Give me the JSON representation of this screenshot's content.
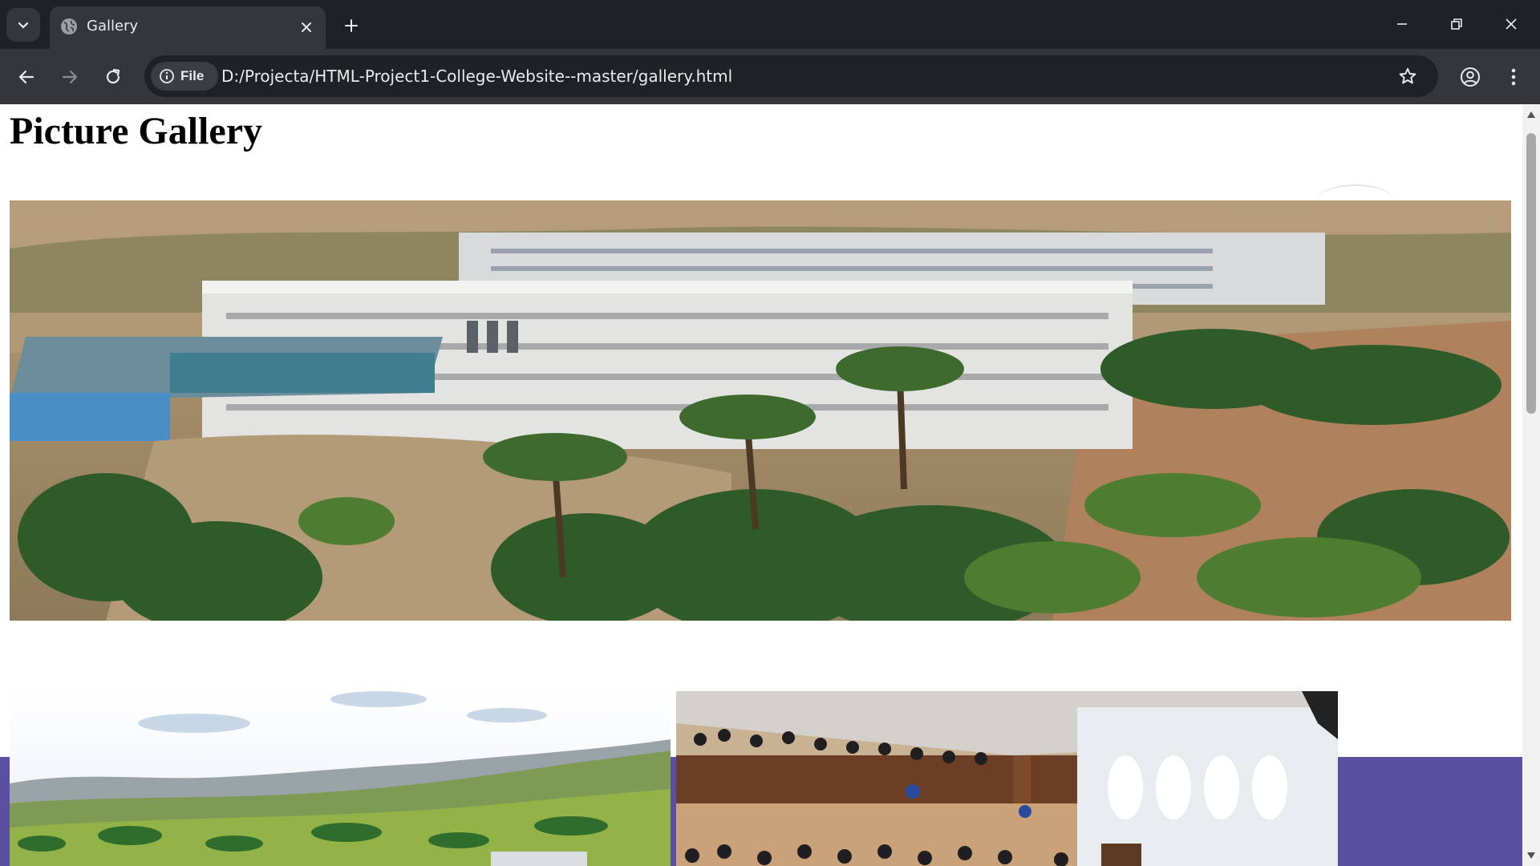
{
  "browser": {
    "tab": {
      "title": "Gallery",
      "favicon": "globe-icon"
    },
    "address_bar": {
      "chip_label": "File",
      "chip_icon": "info-icon",
      "url": "D:/Projecta/HTML-Project1-College-Website--master/gallery.html"
    },
    "icons": {
      "tab_search": "chevron-down-icon",
      "tab_close": "close-icon",
      "new_tab": "plus-icon",
      "minimize": "minimize-icon",
      "restore": "restore-icon",
      "close_window": "close-icon",
      "back": "arrow-left-icon",
      "forward": "arrow-right-icon",
      "reload": "reload-icon",
      "bookmark": "star-icon",
      "profile": "account-icon",
      "menu": "more-vertical-icon"
    },
    "colors": {
      "frame": "#202124",
      "toolbar": "#35363a",
      "text": "#e8eaed"
    }
  },
  "page": {
    "heading": "Picture Gallery",
    "images": [
      {
        "subject": "campus aerial view"
      },
      {
        "subject": "hill landscape"
      },
      {
        "subject": "auditorium crowd"
      }
    ],
    "band_color": "#5b4fa3"
  }
}
